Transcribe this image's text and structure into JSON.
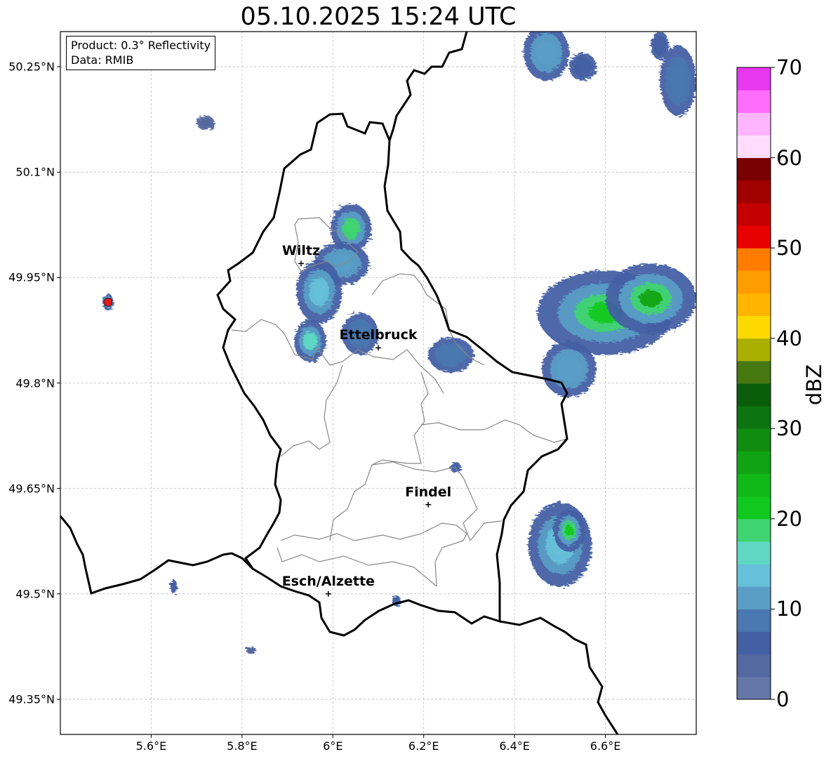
{
  "title": "05.10.2025 15:24 UTC",
  "info": {
    "product": "Product: 0.3° Reflectivity",
    "data_source": "Data: RMIB"
  },
  "map": {
    "lon_range": [
      5.4,
      6.8
    ],
    "lat_range": [
      49.3,
      50.3
    ],
    "lat_ticks": [
      {
        "value": 50.25,
        "label": "50.25°N"
      },
      {
        "value": 50.1,
        "label": "50.1°N"
      },
      {
        "value": 49.95,
        "label": "49.95°N"
      },
      {
        "value": 49.8,
        "label": "49.8°N"
      },
      {
        "value": 49.65,
        "label": "49.65°N"
      },
      {
        "value": 49.5,
        "label": "49.5°N"
      },
      {
        "value": 49.35,
        "label": "49.35°N"
      }
    ],
    "lon_ticks": [
      {
        "value": 5.6,
        "label": "5.6°E"
      },
      {
        "value": 5.8,
        "label": "5.8°E"
      },
      {
        "value": 6.0,
        "label": "6°E"
      },
      {
        "value": 6.2,
        "label": "6.2°E"
      },
      {
        "value": 6.4,
        "label": "6.4°E"
      },
      {
        "value": 6.6,
        "label": "6.6°E"
      }
    ],
    "cities": [
      {
        "name": "Wiltz",
        "lon": 5.93,
        "lat": 49.97
      },
      {
        "name": "Ettelbruck",
        "lon": 6.1,
        "lat": 49.85
      },
      {
        "name": "Findel",
        "lon": 6.21,
        "lat": 49.627
      },
      {
        "name": "Esch/Alzette",
        "lon": 5.99,
        "lat": 49.5
      }
    ],
    "radar_site": {
      "lon": 5.505,
      "lat": 49.915,
      "color": "#e31a1c"
    },
    "border_color": "#000000",
    "canton_color": "#888888",
    "grid": true,
    "echoes": [
      {
        "lon": 6.47,
        "lat": 50.27,
        "rx": 0.05,
        "ry": 0.04,
        "dbz": 10
      },
      {
        "lon": 6.55,
        "lat": 50.25,
        "rx": 0.03,
        "ry": 0.02,
        "dbz": 6
      },
      {
        "lon": 6.76,
        "lat": 50.23,
        "rx": 0.04,
        "ry": 0.05,
        "dbz": 8
      },
      {
        "lon": 6.72,
        "lat": 50.28,
        "rx": 0.02,
        "ry": 0.02,
        "dbz": 5
      },
      {
        "lon": 6.04,
        "lat": 50.02,
        "rx": 0.045,
        "ry": 0.035,
        "dbz": 18
      },
      {
        "lon": 6.02,
        "lat": 49.97,
        "rx": 0.06,
        "ry": 0.03,
        "dbz": 12
      },
      {
        "lon": 5.97,
        "lat": 49.93,
        "rx": 0.05,
        "ry": 0.045,
        "dbz": 14
      },
      {
        "lon": 5.95,
        "lat": 49.86,
        "rx": 0.035,
        "ry": 0.03,
        "dbz": 16
      },
      {
        "lon": 6.06,
        "lat": 49.87,
        "rx": 0.04,
        "ry": 0.03,
        "dbz": 9
      },
      {
        "lon": 6.26,
        "lat": 49.84,
        "rx": 0.05,
        "ry": 0.025,
        "dbz": 8
      },
      {
        "lon": 6.6,
        "lat": 49.9,
        "rx": 0.15,
        "ry": 0.06,
        "dbz": 20
      },
      {
        "lon": 6.7,
        "lat": 49.92,
        "rx": 0.1,
        "ry": 0.05,
        "dbz": 26
      },
      {
        "lon": 6.52,
        "lat": 49.82,
        "rx": 0.06,
        "ry": 0.04,
        "dbz": 12
      },
      {
        "lon": 6.5,
        "lat": 49.57,
        "rx": 0.07,
        "ry": 0.06,
        "dbz": 14
      },
      {
        "lon": 6.52,
        "lat": 49.59,
        "rx": 0.035,
        "ry": 0.03,
        "dbz": 22
      },
      {
        "lon": 5.505,
        "lat": 49.915,
        "rx": 0.012,
        "ry": 0.012,
        "dbz": 20
      },
      {
        "lon": 6.27,
        "lat": 49.68,
        "rx": 0.012,
        "ry": 0.008,
        "dbz": 5
      },
      {
        "lon": 6.14,
        "lat": 49.49,
        "rx": 0.01,
        "ry": 0.008,
        "dbz": 5
      },
      {
        "lon": 5.65,
        "lat": 49.51,
        "rx": 0.008,
        "ry": 0.01,
        "dbz": 5
      },
      {
        "lon": 5.72,
        "lat": 50.17,
        "rx": 0.02,
        "ry": 0.01,
        "dbz": 4
      },
      {
        "lon": 5.82,
        "lat": 49.42,
        "rx": 0.012,
        "ry": 0.005,
        "dbz": 4
      }
    ]
  },
  "colorbar": {
    "label": "dBZ",
    "vmin": 0,
    "vmax": 70,
    "ticks": [
      {
        "value": 0,
        "label": "0"
      },
      {
        "value": 10,
        "label": "10"
      },
      {
        "value": 20,
        "label": "20"
      },
      {
        "value": 30,
        "label": "30"
      },
      {
        "value": 40,
        "label": "40"
      },
      {
        "value": 50,
        "label": "50"
      },
      {
        "value": 60,
        "label": "60"
      },
      {
        "value": 70,
        "label": "70"
      }
    ],
    "colors": [
      "#6577a8",
      "#5469a0",
      "#4460a4",
      "#4a78b0",
      "#5a9ec6",
      "#66c0d9",
      "#5ed8c2",
      "#40d470",
      "#10c820",
      "#10b818",
      "#10a414",
      "#108c10",
      "#0c7410",
      "#0a5e0a",
      "#457810",
      "#aab000",
      "#ffd800",
      "#ffb400",
      "#ff9c00",
      "#ff7c00",
      "#e80000",
      "#c40000",
      "#a00000",
      "#780000",
      "#ffdcfe",
      "#ffb4ff",
      "#ff6cfc",
      "#e838f0"
    ]
  }
}
